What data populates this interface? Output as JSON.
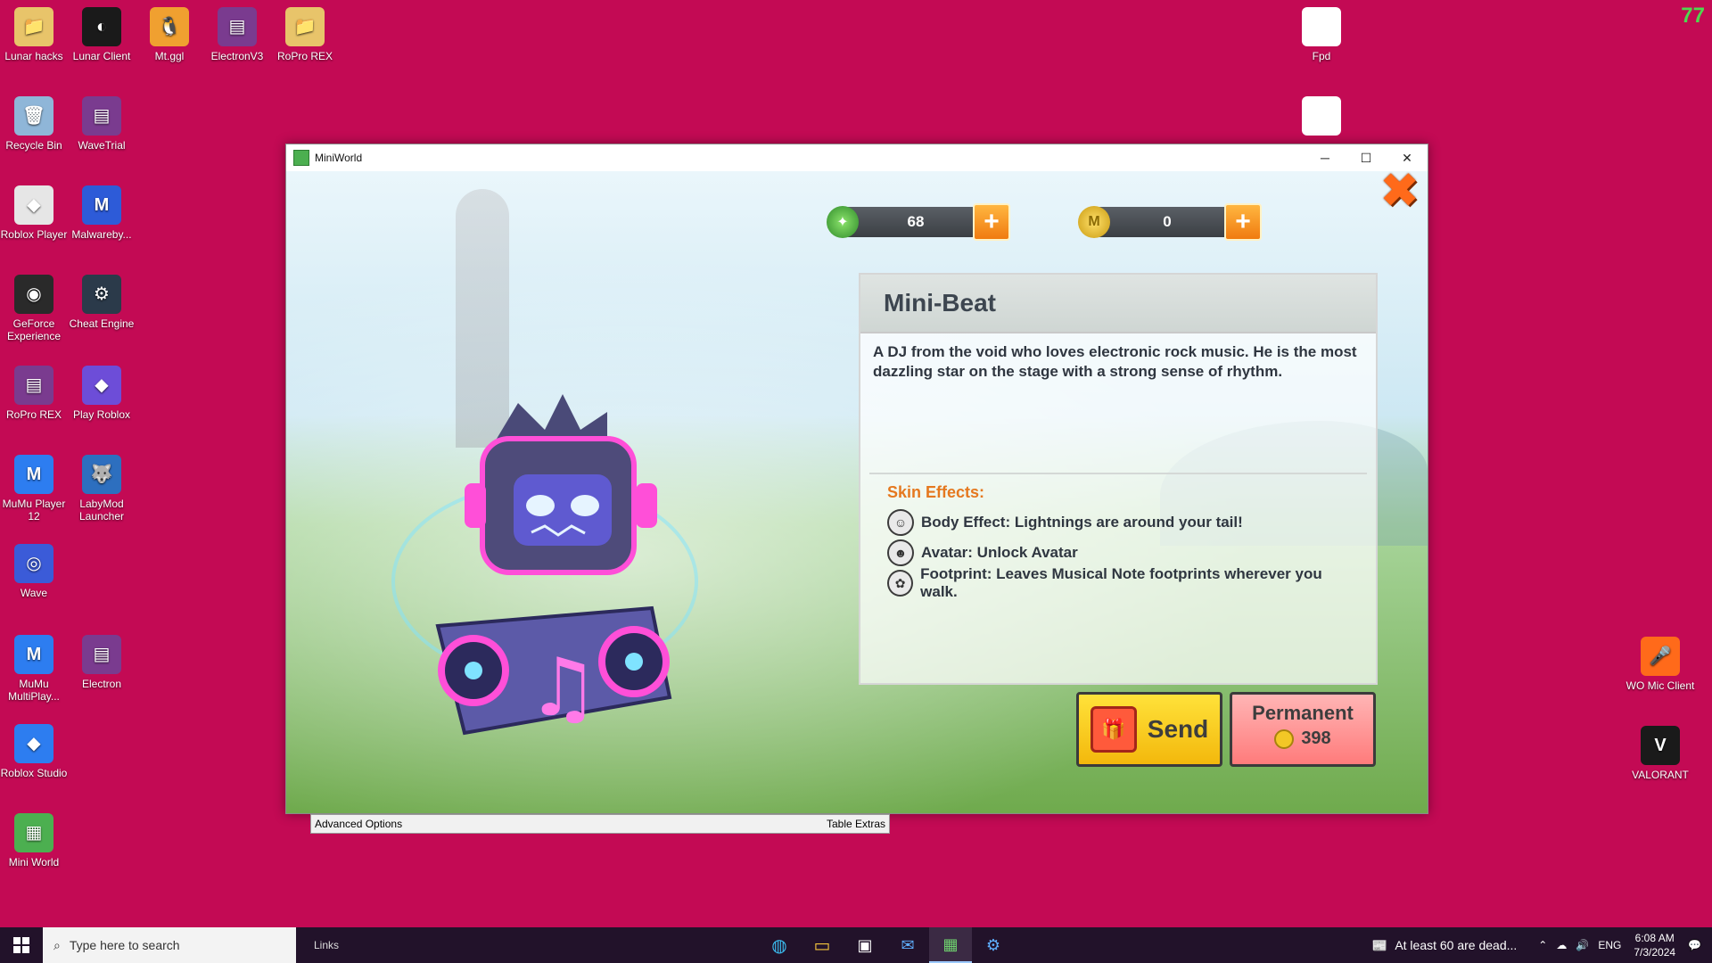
{
  "fps": "77",
  "desktop_icons": [
    {
      "label": "Lunar hacks",
      "color": "#e8c46a",
      "glyph": "📁"
    },
    {
      "label": "Lunar Client",
      "color": "#1a1a1a",
      "glyph": "◐"
    },
    {
      "label": "Mt.ggl",
      "color": "#f0a030",
      "glyph": "🐧"
    },
    {
      "label": "ElectronV3",
      "color": "#7a3b8f",
      "glyph": "▤"
    },
    {
      "label": "RoPro REX",
      "color": "#e8c46a",
      "glyph": "📁"
    },
    {
      "label": "Recycle Bin",
      "color": "#8fb6d8",
      "glyph": "🗑"
    },
    {
      "label": "WaveTrial",
      "color": "#7a3b8f",
      "glyph": "▤"
    },
    {
      "label": "Roblox Player",
      "color": "#e6e6e6",
      "glyph": "◆"
    },
    {
      "label": "Malwareby...",
      "color": "#2d5bd8",
      "glyph": "M"
    },
    {
      "label": "GeForce Experience",
      "color": "#2a2a2a",
      "glyph": "◉"
    },
    {
      "label": "Cheat Engine",
      "color": "#2b3a4a",
      "glyph": "⚙"
    },
    {
      "label": "RoPro REX",
      "color": "#7a3b8f",
      "glyph": "▤"
    },
    {
      "label": "Play Roblox",
      "color": "#6d4dd8",
      "glyph": "◆"
    },
    {
      "label": "MuMu Player 12",
      "color": "#2d7df0",
      "glyph": "M"
    },
    {
      "label": "LabyMod Launcher",
      "color": "#2d6fbf",
      "glyph": "🐺"
    },
    {
      "label": "Wave",
      "color": "#3b5bd8",
      "glyph": "◎"
    },
    {
      "label": "MuMu MultiPlay...",
      "color": "#2d7df0",
      "glyph": "M"
    },
    {
      "label": "Electron",
      "color": "#7a3b8f",
      "glyph": "▤"
    },
    {
      "label": "Roblox Studio",
      "color": "#2d7df0",
      "glyph": "◆"
    },
    {
      "label": "Mini World",
      "color": "#4caf50",
      "glyph": "▦"
    },
    {
      "label": "Fpd",
      "color": "#ffffff",
      "glyph": ""
    },
    {
      "label": "",
      "color": "#ffffff",
      "glyph": ""
    },
    {
      "label": "WO Mic Client",
      "color": "#ff6a1a",
      "glyph": "🎤"
    },
    {
      "label": "VALORANT",
      "color": "#1a1a1a",
      "glyph": "V"
    }
  ],
  "window": {
    "title": "MiniWorld",
    "minimize": "─",
    "maximize": "☐",
    "close": "✕"
  },
  "game": {
    "mini_beans": "68",
    "mini_coins": "0",
    "plus": "+",
    "close_x": "✖",
    "skin_name": "Mini-Beat",
    "description": "A DJ from the void who loves electronic rock music. He is the most dazzling star on the stage with a strong sense of rhythm.",
    "effects_title": "Skin Effects:",
    "effects": [
      {
        "icon": "body-effect-icon",
        "glyph": "☺",
        "text": "Body Effect: Lightnings are around your tail!"
      },
      {
        "icon": "avatar-icon",
        "glyph": "☻",
        "text": "Avatar: Unlock Avatar"
      },
      {
        "icon": "footprint-icon",
        "glyph": "✿",
        "text": "Footprint: Leaves Musical Note footprints wherever you walk."
      }
    ],
    "send_label": "Send",
    "permanent_label": "Permanent",
    "permanent_price": "398"
  },
  "strip": {
    "left": "Advanced Options",
    "right": "Table Extras"
  },
  "taskbar": {
    "search_placeholder": "Type here to search",
    "links": "Links",
    "news": "At least 60 are dead...",
    "lang": "ENG",
    "time": "6:08 AM",
    "date": "7/3/2024"
  }
}
